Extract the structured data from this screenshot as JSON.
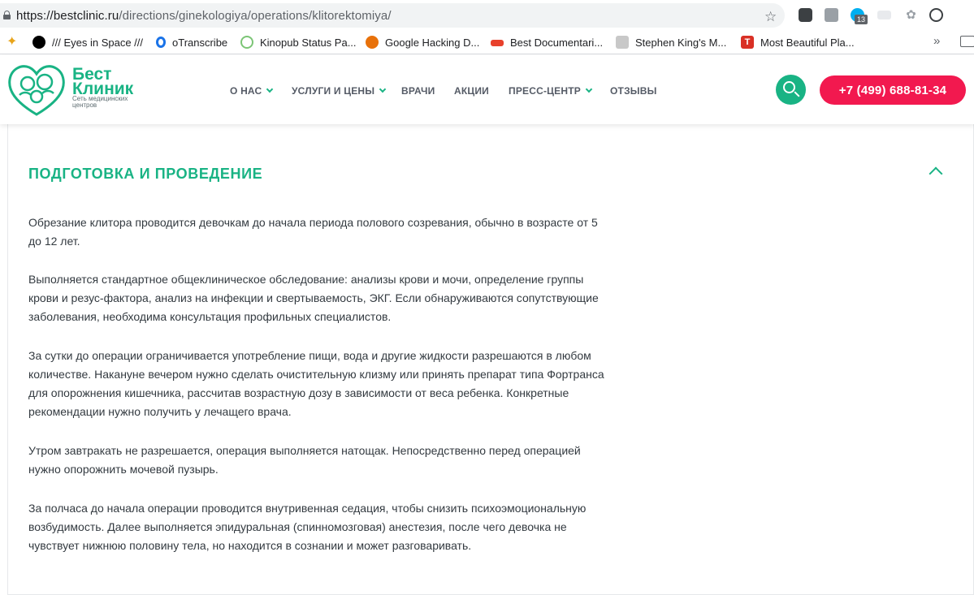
{
  "browser": {
    "url_host": "https://bestclinic.ru",
    "url_path": "/directions/ginekologiya/operations/klitorektomiya/",
    "extension_badge": "13",
    "icons": [
      "lock-icon",
      "star-icon",
      "pocket-icon",
      "extension-icon",
      "skype-icon",
      "paw-icon",
      "sync-icon"
    ]
  },
  "bookmarks": [
    {
      "label": "/// Eyes in Space ///",
      "color": "#000000"
    },
    {
      "label": "oTranscribe",
      "color": "#1a73e8"
    },
    {
      "label": "Kinopub Status Pa...",
      "color": "#7cc576"
    },
    {
      "label": "Google Hacking D...",
      "color": "#e8710a"
    },
    {
      "label": "Best Documentari...",
      "color": "#e8412c"
    },
    {
      "label": "Stephen King's M...",
      "color": "#c8c8c8"
    },
    {
      "label": "Most Beautiful Pla...",
      "color": "#d93025"
    }
  ],
  "bookmarks_more": "»",
  "site": {
    "logo": {
      "name_line1": "Бест",
      "name_line2": "Клиник",
      "subtitle_line1": "Сеть медицинских",
      "subtitle_line2": "центров"
    },
    "nav": [
      {
        "label": "О НАС",
        "has_dropdown": true
      },
      {
        "label": "УСЛУГИ И ЦЕНЫ",
        "has_dropdown": true
      },
      {
        "label": "ВРАЧИ",
        "has_dropdown": false
      },
      {
        "label": "АКЦИИ",
        "has_dropdown": false
      },
      {
        "label": "ПРЕСС-ЦЕНТР",
        "has_dropdown": true
      },
      {
        "label": "ОТЗЫВЫ",
        "has_dropdown": false
      }
    ],
    "phone": "+7 (499) 688-81-34",
    "colors": {
      "brand_green": "#19b384",
      "accent_red": "#f2194f"
    }
  },
  "section": {
    "title": "ПОДГОТОВКА И ПРОВЕДЕНИЕ",
    "paragraphs": [
      [
        "Обрезание клитора проводится девочкам до начала периода полового созревания, обычно в возрасте от 5",
        "до 12 лет."
      ],
      [
        "Выполняется стандартное общеклиническое обследование: анализы крови и мочи, определение группы",
        "крови и резус-фактора, анализ на инфекции и свертываемость, ЭКГ. Если обнаруживаются сопутствующие",
        "заболевания, необходима консультация профильных специалистов."
      ],
      [
        "За сутки до операции ограничивается употребление пищи, вода и другие жидкости разрешаются в любом",
        "количестве. Накануне вечером нужно сделать очистительную клизму или принять препарат типа Фортранса",
        "для опорожнения кишечника, рассчитав возрастную дозу в зависимости от веса ребенка. Конкретные",
        "рекомендации нужно получить у лечащего врача."
      ],
      [
        "Утром завтракать не разрешается, операция выполняется натощак. Непосредственно перед операцией",
        "нужно опорожнить мочевой пузырь."
      ],
      [
        "За полчаса до начала операции проводится внутривенная седация, чтобы снизить психоэмоциональную",
        "возбудимость. Далее выполняется эпидуральная (спинномозговая) анестезия, после чего девочка не",
        "чувствует нижнюю половину тела, но находится в сознании и может разговаривать."
      ]
    ]
  }
}
